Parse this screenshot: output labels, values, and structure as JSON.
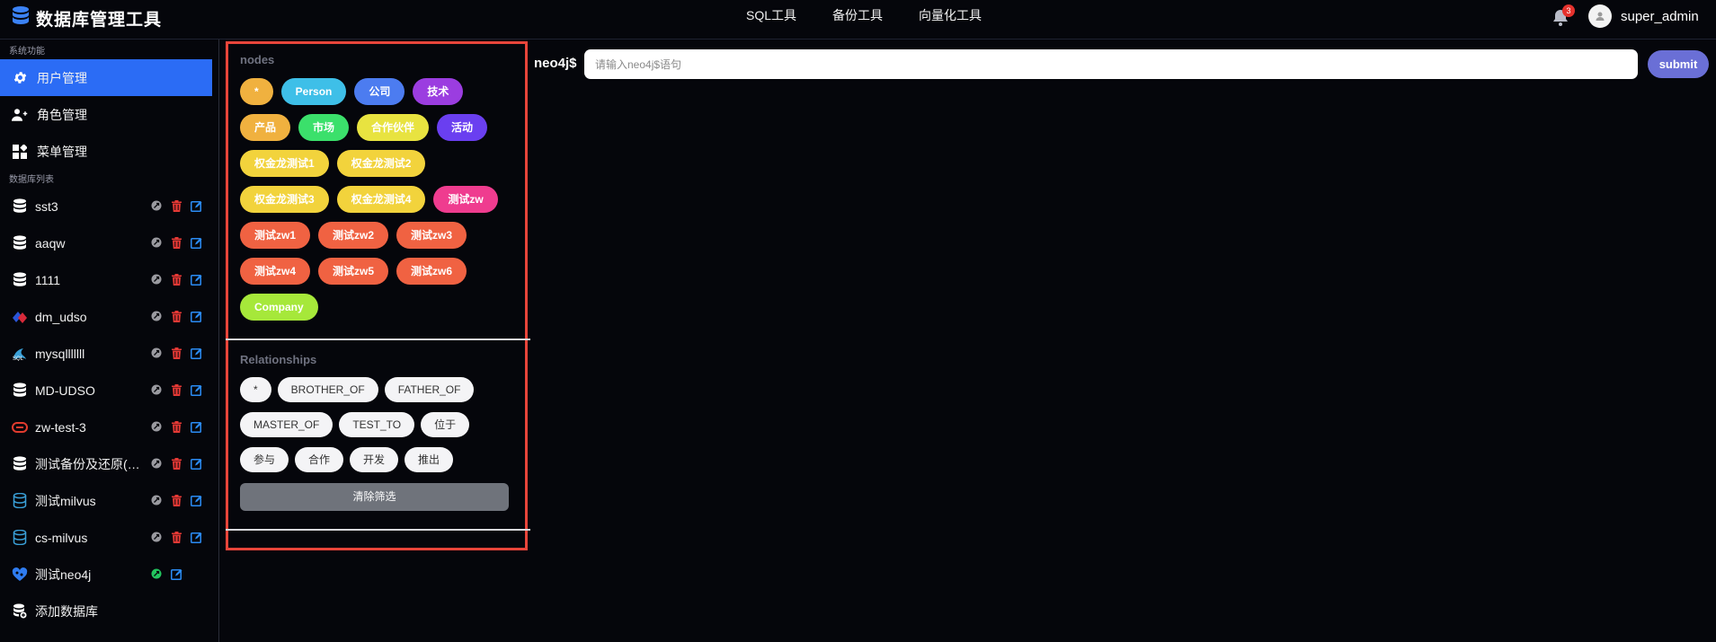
{
  "app": {
    "title": "数据库管理工具"
  },
  "topnav": [
    {
      "label": "SQL工具"
    },
    {
      "label": "备份工具"
    },
    {
      "label": "向量化工具"
    }
  ],
  "notifications": {
    "count": "3"
  },
  "user": {
    "name": "super_admin"
  },
  "sidebar": {
    "system_label": "系统功能",
    "system_items": [
      {
        "label": "用户管理",
        "icon": "gear-icon",
        "active": true
      },
      {
        "label": "角色管理",
        "icon": "user-group-icon"
      },
      {
        "label": "菜单管理",
        "icon": "grid-icon"
      }
    ],
    "db_label": "数据库列表",
    "databases": [
      {
        "name": "sst3",
        "icon": "database-icon",
        "status_color": "#9a9aa0"
      },
      {
        "name": "aaqw",
        "icon": "database-icon",
        "status_color": "#9a9aa0"
      },
      {
        "name": "1111",
        "icon": "database-icon",
        "status_color": "#9a9aa0"
      },
      {
        "name": "dm_udso",
        "icon": "dameng-icon",
        "status_color": "#9a9aa0"
      },
      {
        "name": "mysqlllllll",
        "icon": "mysql-icon",
        "status_color": "#9a9aa0"
      },
      {
        "name": "MD-UDSO",
        "icon": "database-icon",
        "status_color": "#9a9aa0"
      },
      {
        "name": "zw-test-3",
        "icon": "oracle-icon",
        "status_color": "#9a9aa0"
      },
      {
        "name": "测试备份及还原(…",
        "icon": "database-icon",
        "status_color": "#9a9aa0"
      },
      {
        "name": "测试milvus",
        "icon": "milvus-icon",
        "status_color": "#9a9aa0"
      },
      {
        "name": "cs-milvus",
        "icon": "milvus-icon",
        "status_color": "#9a9aa0"
      },
      {
        "name": "测试neo4j",
        "icon": "neo4j-icon",
        "status_color": "#22c55e"
      }
    ],
    "add_db_label": "添加数据库"
  },
  "filter": {
    "nodes_title": "nodes",
    "nodes": [
      {
        "label": "*",
        "color": "#f0b13f"
      },
      {
        "label": "Person",
        "color": "#3ebfe8"
      },
      {
        "label": "公司",
        "color": "#4c7cf0"
      },
      {
        "label": "技术",
        "color": "#9b3de0"
      },
      {
        "label": "产品",
        "color": "#f0b13f"
      },
      {
        "label": "市场",
        "color": "#3be06b"
      },
      {
        "label": "合作伙伴",
        "color": "#e8e340"
      },
      {
        "label": "活动",
        "color": "#6a3ff0"
      },
      {
        "label": "权金龙测试1",
        "color": "#f2d33c"
      },
      {
        "label": "权金龙测试2",
        "color": "#f2d33c"
      },
      {
        "label": "权金龙测试3",
        "color": "#f2d33c"
      },
      {
        "label": "权金龙测试4",
        "color": "#f2d33c"
      },
      {
        "label": "测试zw",
        "color": "#ef3c8f"
      },
      {
        "label": "测试zw1",
        "color": "#f06242"
      },
      {
        "label": "测试zw2",
        "color": "#f06242"
      },
      {
        "label": "测试zw3",
        "color": "#f06242"
      },
      {
        "label": "测试zw4",
        "color": "#f06242"
      },
      {
        "label": "测试zw5",
        "color": "#f06242"
      },
      {
        "label": "测试zw6",
        "color": "#f06242"
      },
      {
        "label": "Company",
        "color": "#a6e83a"
      }
    ],
    "relationships_title": "Relationships",
    "relationships": [
      {
        "label": "*"
      },
      {
        "label": "BROTHER_OF"
      },
      {
        "label": "FATHER_OF"
      },
      {
        "label": "MASTER_OF"
      },
      {
        "label": "TEST_TO"
      },
      {
        "label": "位于"
      },
      {
        "label": "参与"
      },
      {
        "label": "合作"
      },
      {
        "label": "开发"
      },
      {
        "label": "推出"
      }
    ],
    "clear_label": "清除筛选"
  },
  "query": {
    "prompt": "neo4j$",
    "placeholder": "请输入neo4j$语句",
    "value": "",
    "submit_label": "submit"
  },
  "colors": {
    "accent": "#2b6cf5",
    "highlight_border": "#e8453a",
    "submit": "#6a6fd6",
    "delete": "#e53935",
    "edit": "#2b8cf5"
  }
}
